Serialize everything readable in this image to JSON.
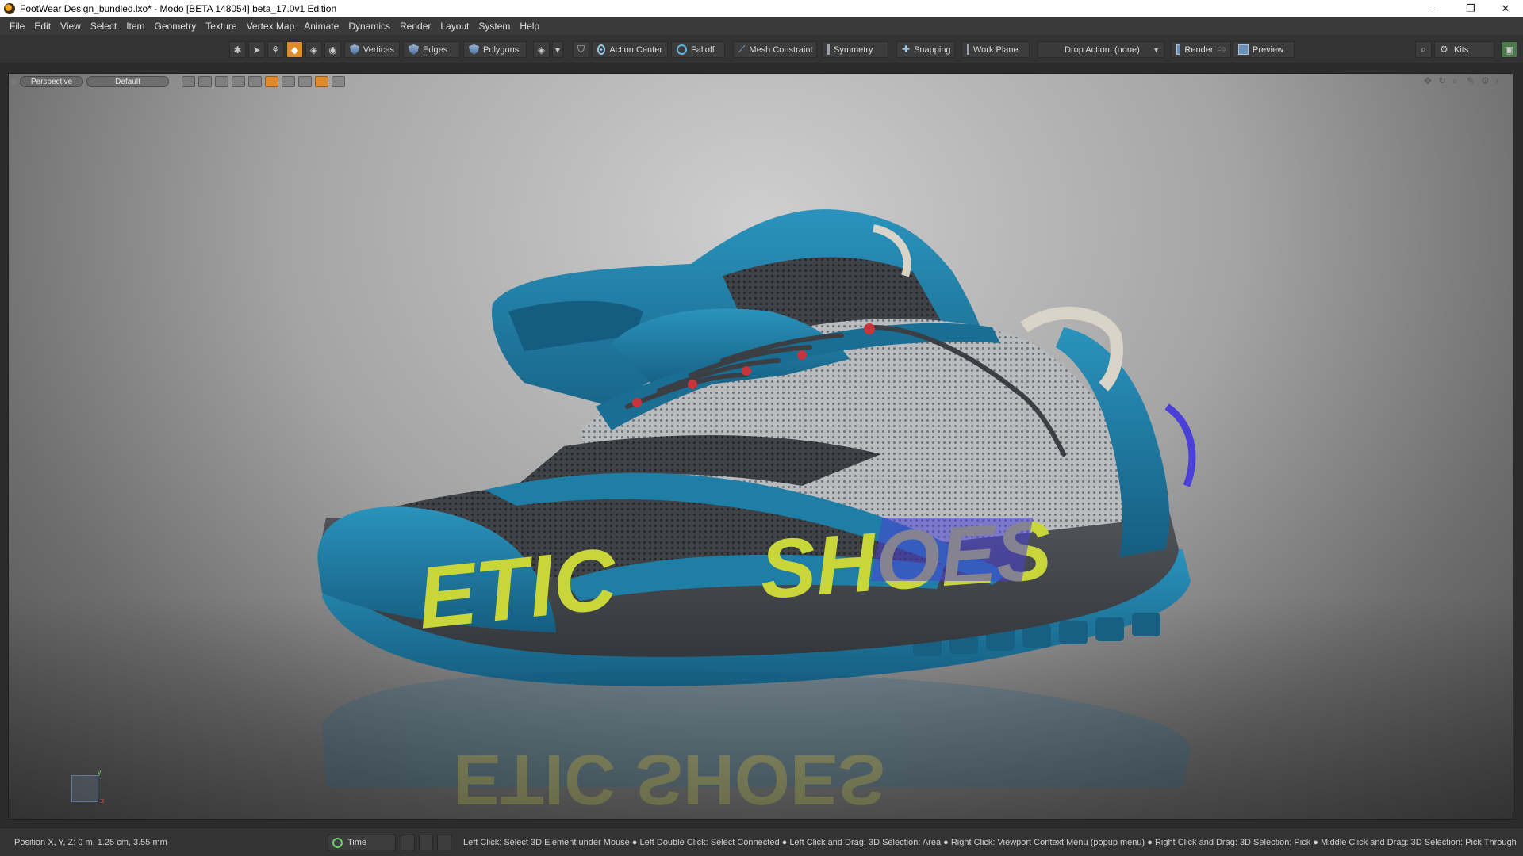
{
  "window": {
    "title": "FootWear Design_bundled.lxo* - Modo [BETA 148054]   beta_17.0v1 Edition",
    "minimize": "–",
    "restore": "❐",
    "close": "✕"
  },
  "menu": [
    "File",
    "Edit",
    "View",
    "Select",
    "Item",
    "Geometry",
    "Texture",
    "Vertex Map",
    "Animate",
    "Dynamics",
    "Render",
    "Layout",
    "System",
    "Help"
  ],
  "toolbar": {
    "vertices": "Vertices",
    "edges": "Edges",
    "polygons": "Polygons",
    "action_center": "Action Center",
    "falloff": "Falloff",
    "mesh_constraint": "Mesh Constraint",
    "symmetry": "Symmetry",
    "snapping": "Snapping",
    "work_plane": "Work Plane",
    "drop_action": "Drop Action: (none)",
    "render": "Render",
    "render_shortcut": "F9",
    "preview": "Preview",
    "kits": "Kits"
  },
  "viewport": {
    "view_mode": "Perspective",
    "style": "Default"
  },
  "scene": {
    "sole_text_front": "ETIC",
    "sole_text_back": "SHOES",
    "reflection_text": "ETIC SHOES",
    "colors": {
      "upper_blue": "#1f7ea6",
      "upper_blue_dark": "#155d80",
      "mesh_dark": "#3f4246",
      "mesh_light": "#b9bcbf",
      "midsole": "#4b4e52",
      "logo_yellow": "#c9d63a",
      "logo_purple": "#4a3fd6",
      "lace": "#3b3f44",
      "eyelet_red": "#c8343b",
      "collar_cream": "#d9d4c7"
    }
  },
  "status": {
    "position": "Position X, Y, Z:   0 m, 1.25 cm, 3.55 mm",
    "time_label": "Time",
    "hints": "Left Click: Select 3D Element under Mouse ● Left Double Click: Select Connected ● Left Click and Drag: 3D Selection: Area ● Right Click: Viewport Context Menu (popup menu) ● Right Click and Drag: 3D Selection: Pick ● Middle Click and Drag: 3D Selection: Pick Through"
  }
}
